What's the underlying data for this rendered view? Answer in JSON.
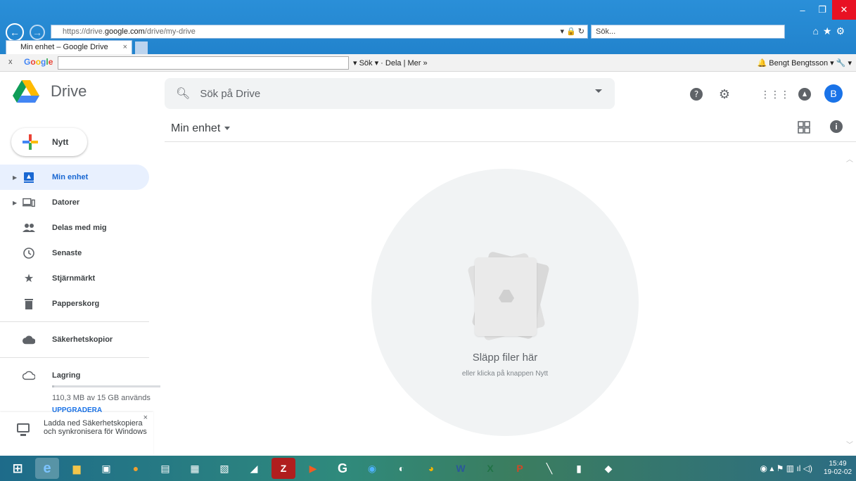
{
  "browser": {
    "url_prefix": "https://drive.",
    "url_host": "google.com",
    "url_path": "/drive/my-drive",
    "search_placeholder": "Sök...",
    "tab_title": "Min enhet – Google Drive",
    "toolbar": {
      "close_label": "x",
      "brand": "Google",
      "search_btn": "Sök",
      "share_btn": "Dela",
      "more_btn": "Mer",
      "user": "Bengt Bengtsson"
    }
  },
  "app": {
    "product": "Drive",
    "search_placeholder": "Sök på Drive",
    "avatar_letter": "B",
    "breadcrumb": "Min enhet",
    "new_button": "Nytt",
    "nav": [
      {
        "label": "Min enhet",
        "icon": "drive-icon",
        "active": true
      },
      {
        "label": "Datorer",
        "icon": "computers-icon"
      },
      {
        "label": "Delas med mig",
        "icon": "shared-icon"
      },
      {
        "label": "Senaste",
        "icon": "recent-icon"
      },
      {
        "label": "Stjärnmärkt",
        "icon": "star-icon"
      },
      {
        "label": "Papperskorg",
        "icon": "trash-icon"
      },
      {
        "label": "Säkerhetskopior",
        "icon": "cloud-icon"
      },
      {
        "label": "Lagring",
        "icon": "storage-icon"
      }
    ],
    "storage": {
      "used_text": "110,3 MB av 15 GB används",
      "used_fraction": 0.007,
      "upgrade": "UPPGRADERA"
    },
    "promo": {
      "text": "Ladda ned Säkerhetskopiera och synkronisera för Windows"
    },
    "empty": {
      "title": "Släpp filer här",
      "subtitle": "eller klicka på knappen Nytt"
    }
  },
  "taskbar": {
    "time": "15:49",
    "date": "19-02-02"
  },
  "colors": {
    "accent": "#1a73e8",
    "active_bg": "#e8f0fe"
  }
}
